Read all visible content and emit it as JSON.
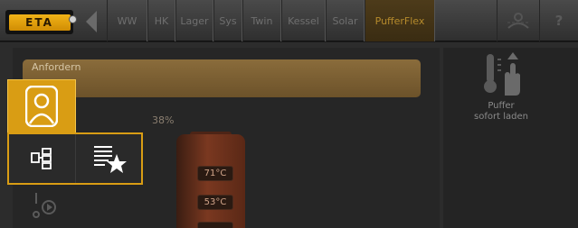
{
  "app": {
    "logo_text": "ETA",
    "back_icon": "chevron-left-icon"
  },
  "tabs": [
    {
      "label": "WW",
      "active": false
    },
    {
      "label": "HK",
      "active": false
    },
    {
      "label": "Lager",
      "active": false
    },
    {
      "label": "Sys",
      "active": false
    },
    {
      "label": "Twin",
      "active": false
    },
    {
      "label": "Kessel",
      "active": false
    },
    {
      "label": "Solar",
      "active": false
    },
    {
      "label": "PufferFlex",
      "active": true
    }
  ],
  "toolbar": {
    "picture_icon": "pictogram-icon",
    "help_label": "?"
  },
  "content": {
    "request_label": "Anfordern",
    "fill_level": "38%",
    "temps": [
      "71°C",
      "53°C"
    ],
    "puffer_label_line1": "Puffer",
    "puffer_label_line2": "sofort laden",
    "puffer_icon": "thermometer-hand-icon"
  },
  "menu": {
    "items": [
      {
        "icon": "user-icon",
        "selected": true
      },
      {
        "icon": "overview-icon"
      },
      {
        "icon": "favorites-list-icon"
      },
      {
        "icon": "play-settings-icon"
      }
    ]
  },
  "colors": {
    "accent": "#d99d14",
    "active_tab_text": "#b58a2c",
    "tank": "#7a3820"
  }
}
